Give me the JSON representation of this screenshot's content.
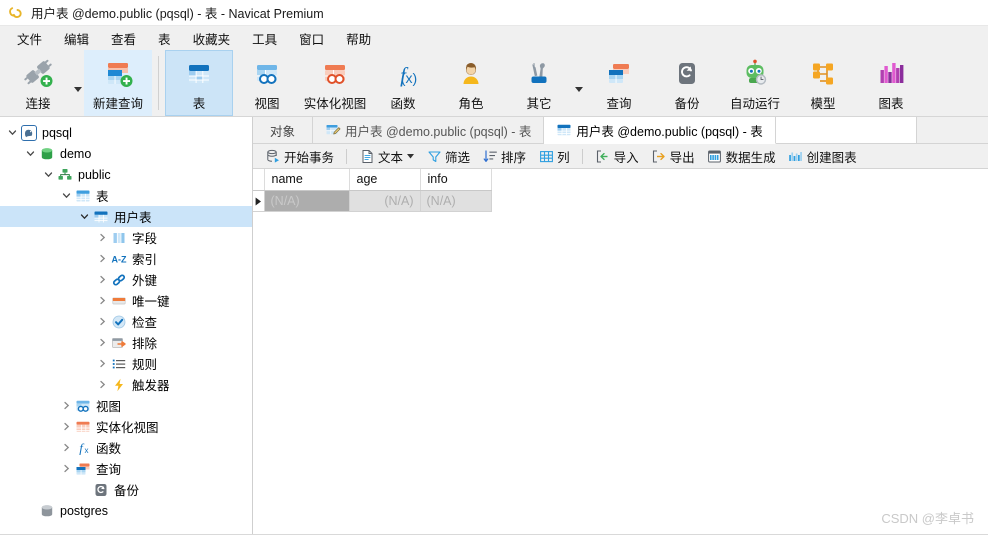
{
  "window": {
    "title": "用户表 @demo.public (pqsql) - 表 - Navicat Premium",
    "logo_icon": "navicat-logo-icon"
  },
  "menubar": {
    "items": [
      {
        "label": "文件",
        "name": "menu-file"
      },
      {
        "label": "编辑",
        "name": "menu-edit"
      },
      {
        "label": "查看",
        "name": "menu-view"
      },
      {
        "label": "表",
        "name": "menu-table"
      },
      {
        "label": "收藏夹",
        "name": "menu-favorites"
      },
      {
        "label": "工具",
        "name": "menu-tools"
      },
      {
        "label": "窗口",
        "name": "menu-window"
      },
      {
        "label": "帮助",
        "name": "menu-help"
      }
    ]
  },
  "toolbar": {
    "buttons": [
      {
        "label": "连接",
        "icon": "connection-plug-add-icon",
        "state": "normal",
        "has_caret": true
      },
      {
        "label": "新建查询",
        "icon": "new-query-add-icon",
        "state": "soft-highlight",
        "has_caret": false
      },
      {
        "label": "表",
        "icon": "table-icon",
        "state": "active",
        "has_caret": false
      },
      {
        "label": "视图",
        "icon": "view-icon",
        "state": "normal",
        "has_caret": false
      },
      {
        "label": "实体化视图",
        "icon": "materialized-view-icon",
        "state": "normal",
        "has_caret": false
      },
      {
        "label": "函数",
        "icon": "function-fx-icon",
        "state": "normal",
        "has_caret": false
      },
      {
        "label": "角色",
        "icon": "role-user-icon",
        "state": "normal",
        "has_caret": false
      },
      {
        "label": "其它",
        "icon": "other-tools-icon",
        "state": "normal",
        "has_caret": true
      },
      {
        "label": "查询",
        "icon": "query-icon",
        "state": "normal",
        "has_caret": false
      },
      {
        "label": "备份",
        "icon": "backup-icon",
        "state": "normal",
        "has_caret": false
      },
      {
        "label": "自动运行",
        "icon": "automation-robot-icon",
        "state": "normal",
        "has_caret": false
      },
      {
        "label": "模型",
        "icon": "model-diagram-icon",
        "state": "normal",
        "has_caret": false
      },
      {
        "label": "图表",
        "icon": "chart-bars-icon",
        "state": "normal",
        "has_caret": false
      }
    ]
  },
  "sidebar": {
    "tree": [
      {
        "label": "pqsql",
        "indent": 0,
        "icon": "postgres-elephant-icon",
        "twisty": "expanded",
        "selected": false
      },
      {
        "label": "demo",
        "indent": 1,
        "icon": "database-green-icon",
        "twisty": "expanded",
        "selected": false
      },
      {
        "label": "public",
        "indent": 2,
        "icon": "schema-icon",
        "twisty": "expanded",
        "selected": false
      },
      {
        "label": "表",
        "indent": 3,
        "icon": "tables-folder-icon",
        "twisty": "expanded",
        "selected": false
      },
      {
        "label": "用户表",
        "indent": 4,
        "icon": "table-icon",
        "twisty": "expanded",
        "selected": true
      },
      {
        "label": "字段",
        "indent": 5,
        "icon": "fields-icon",
        "twisty": "collapsed",
        "selected": false
      },
      {
        "label": "索引",
        "indent": 5,
        "icon": "index-az-icon",
        "twisty": "collapsed",
        "selected": false
      },
      {
        "label": "外键",
        "indent": 5,
        "icon": "foreign-key-link-icon",
        "twisty": "collapsed",
        "selected": false
      },
      {
        "label": "唯一键",
        "indent": 5,
        "icon": "unique-key-icon",
        "twisty": "collapsed",
        "selected": false
      },
      {
        "label": "检查",
        "indent": 5,
        "icon": "check-circle-icon",
        "twisty": "collapsed",
        "selected": false
      },
      {
        "label": "排除",
        "indent": 5,
        "icon": "exclude-icon",
        "twisty": "collapsed",
        "selected": false
      },
      {
        "label": "规则",
        "indent": 5,
        "icon": "rules-list-icon",
        "twisty": "collapsed",
        "selected": false
      },
      {
        "label": "触发器",
        "indent": 5,
        "icon": "trigger-bolt-icon",
        "twisty": "collapsed",
        "selected": false
      },
      {
        "label": "视图",
        "indent": 3,
        "icon": "view-icon",
        "twisty": "collapsed",
        "selected": false
      },
      {
        "label": "实体化视图",
        "indent": 3,
        "icon": "materialized-view-icon",
        "twisty": "collapsed",
        "selected": false
      },
      {
        "label": "函数",
        "indent": 3,
        "icon": "function-fx-icon",
        "twisty": "collapsed",
        "selected": false
      },
      {
        "label": "查询",
        "indent": 3,
        "icon": "query-icon",
        "twisty": "collapsed",
        "selected": false
      },
      {
        "label": "备份",
        "indent": 3,
        "icon": "backup-icon",
        "twisty": "none",
        "selected": false
      },
      {
        "label": "postgres",
        "indent": 1,
        "icon": "database-grey-icon",
        "twisty": "none",
        "selected": false
      }
    ]
  },
  "tabs": [
    {
      "label": "对象",
      "icon": "none",
      "active": false,
      "name": "tab-objects"
    },
    {
      "label": "用户表 @demo.public (pqsql) - 表",
      "icon": "design-table-icon",
      "active": false,
      "name": "tab-design-table"
    },
    {
      "label": "用户表 @demo.public (pqsql) - 表",
      "icon": "table-icon",
      "active": true,
      "name": "tab-table-data"
    }
  ],
  "data_toolbar": {
    "groups": [
      [
        {
          "label": "开始事务",
          "icon": "begin-transaction-icon",
          "caret": false
        }
      ],
      [
        {
          "label": "文本",
          "icon": "text-document-icon",
          "caret": true
        },
        {
          "label": "筛选",
          "icon": "filter-funnel-icon",
          "caret": false
        },
        {
          "label": "排序",
          "icon": "sort-icon",
          "caret": false
        },
        {
          "label": "列",
          "icon": "columns-grid-icon",
          "caret": false
        }
      ],
      [
        {
          "label": "导入",
          "icon": "import-icon",
          "caret": false
        },
        {
          "label": "导出",
          "icon": "export-icon",
          "caret": false
        },
        {
          "label": "数据生成",
          "icon": "data-generation-icon",
          "caret": false
        },
        {
          "label": "创建图表",
          "icon": "create-chart-icon",
          "caret": false
        }
      ]
    ]
  },
  "grid": {
    "columns": [
      "name",
      "age",
      "info"
    ],
    "rows": [
      {
        "marker": "current",
        "cells": [
          "(N/A)",
          "(N/A)",
          "(N/A)"
        ],
        "selected_cell_index": 0
      }
    ]
  },
  "watermark": {
    "text": "CSDN @李卓书"
  },
  "colors": {
    "accent_blue": "#1e88d4",
    "selection_blue": "#cbe4f9",
    "toolbar_bg": "#f0f0f0",
    "grid_row_bg": "#e0e0e0",
    "grid_selected_cell": "#adadad",
    "orange": "#ea6a47",
    "green": "#4caf50",
    "yellow": "#f0b323"
  }
}
